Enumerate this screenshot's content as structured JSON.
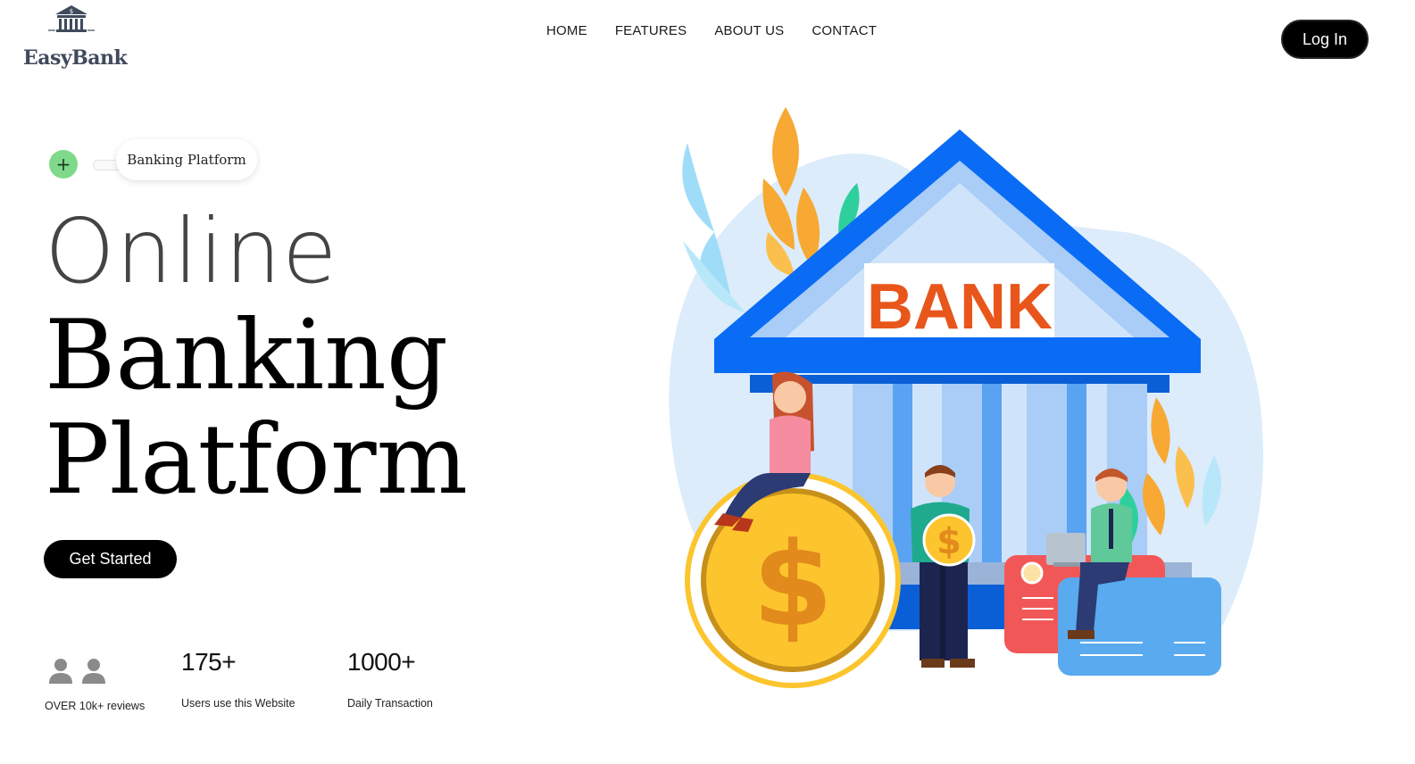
{
  "brand": {
    "name": "EasyBank"
  },
  "nav": {
    "items": [
      {
        "label": "HOME"
      },
      {
        "label": "FEATURES"
      },
      {
        "label": "ABOUT US"
      },
      {
        "label": "CONTACT"
      }
    ]
  },
  "header": {
    "login_label": "Log In"
  },
  "hero": {
    "pill_label": "Banking Platform",
    "plus_icon": "+",
    "line1": "Online",
    "line2": "Banking",
    "line3": "Platform",
    "cta_label": "Get Started"
  },
  "stats": {
    "reviews_caption": "OVER 10k+ reviews",
    "users_number": "175+",
    "users_caption": "Users use this Website",
    "transactions_number": "1000+",
    "transactions_caption": "Daily Transaction"
  },
  "illustration": {
    "sign_text": "BANK",
    "dollar_symbol": "$"
  },
  "colors": {
    "accent_green": "#7fd98a",
    "bank_blue": "#0a6cf5",
    "bank_light": "#cfe4fb",
    "coin_gold": "#fcc52e",
    "sign_orange": "#e8561c",
    "button_black": "#000000"
  }
}
